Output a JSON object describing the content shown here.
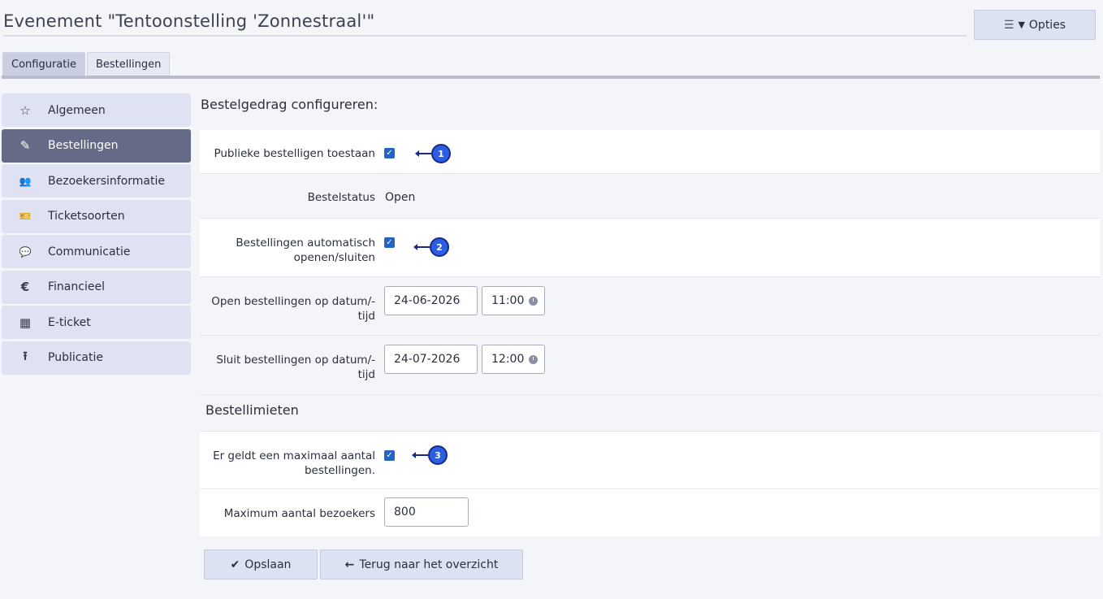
{
  "page": {
    "title": "Evenement \"Tentoonstelling 'Zonnestraal'\"",
    "options_label": "Opties",
    "options_icon": "sliders-icon"
  },
  "tabs": [
    {
      "label": "Configuratie",
      "active": true
    },
    {
      "label": "Bestellingen",
      "active": false
    }
  ],
  "sidebar": {
    "items": [
      {
        "label": "Algemeen",
        "icon": "star-icon",
        "glyph": "☆"
      },
      {
        "label": "Bestellingen",
        "icon": "pencil-icon",
        "glyph": "✎",
        "active": true
      },
      {
        "label": "Bezoekersinformatie",
        "icon": "users-icon",
        "glyph": "👥"
      },
      {
        "label": "Ticketsoorten",
        "icon": "ticket-icon",
        "glyph": "🎫"
      },
      {
        "label": "Communicatie",
        "icon": "chat-icon",
        "glyph": "💬"
      },
      {
        "label": "Financieel",
        "icon": "euro-icon",
        "glyph": "€"
      },
      {
        "label": "E-ticket",
        "icon": "qr-code-icon",
        "glyph": "▦"
      },
      {
        "label": "Publicatie",
        "icon": "upload-icon",
        "glyph": "⭱"
      }
    ]
  },
  "main": {
    "section_title": "Bestelgedrag configureren:",
    "public_orders_label": "Publieke bestelligen toestaan",
    "public_orders_checked": true,
    "order_status_label": "Bestelstatus",
    "order_status_value": "Open",
    "auto_open_close_label_1": "Bestellingen automatisch",
    "auto_open_close_label_2": "openen/sluiten",
    "auto_open_close_checked": true,
    "open_datetime_label_1": "Open bestellingen op datum/-",
    "open_datetime_label_2": "tijd",
    "open_date": "24-06-2026",
    "open_time": "11:00",
    "close_datetime_label_1": "Sluit bestellingen op datum/-",
    "close_datetime_label_2": "tijd",
    "close_date": "24-07-2026",
    "close_time": "12:00",
    "limits_title": "Bestellimieten",
    "max_orders_label_1": "Er geldt een maximaal aantal",
    "max_orders_label_2": "bestellingen.",
    "max_orders_checked": true,
    "max_visitors_label": "Maximum aantal bezoekers",
    "max_visitors_value": "800"
  },
  "annotations": [
    "1",
    "2",
    "3"
  ],
  "actions": {
    "save_label": "Opslaan",
    "back_label": "Terug naar het overzicht"
  },
  "colors": {
    "accent": "#2563c4",
    "sidebar_active": "#656a86",
    "annotation": "#2c5ee0"
  }
}
